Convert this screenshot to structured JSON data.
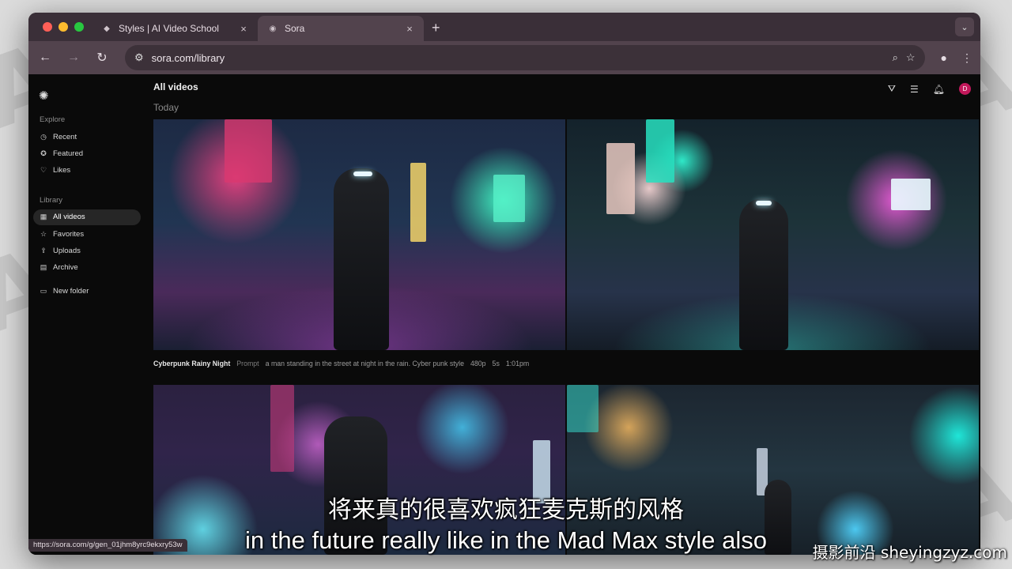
{
  "browser": {
    "tabs": [
      {
        "title": "Styles | AI Video School",
        "favicon": "ai-vs-icon",
        "close": "×"
      },
      {
        "title": "Sora",
        "favicon": "play-circle-icon",
        "close": "×"
      }
    ],
    "new_tab": "+",
    "address": "sora.com/library",
    "status_url": "https://sora.com/g/gen_01jhm8yrc9ekxry53w"
  },
  "sidebar": {
    "explore_label": "Explore",
    "explore_items": [
      {
        "label": "Recent",
        "icon": "clock-icon"
      },
      {
        "label": "Featured",
        "icon": "star-badge-icon"
      },
      {
        "label": "Likes",
        "icon": "heart-icon"
      }
    ],
    "library_label": "Library",
    "library_items": [
      {
        "label": "All videos",
        "icon": "grid-icon",
        "active": true
      },
      {
        "label": "Favorites",
        "icon": "star-icon"
      },
      {
        "label": "Uploads",
        "icon": "upload-icon"
      },
      {
        "label": "Archive",
        "icon": "archive-icon"
      }
    ],
    "new_folder": "New folder"
  },
  "main": {
    "title": "All videos",
    "group_label": "Today",
    "avatar_initial": "D",
    "video": {
      "title": "Cyberpunk Rainy Night",
      "prompt_label": "Prompt",
      "prompt": "a man standing in the street at night in the rain. Cyber punk style",
      "resolution": "480p",
      "duration": "5s",
      "time": "1:01pm"
    }
  },
  "overlay": {
    "subtitle_cn": "将来真的很喜欢疯狂麦克斯的风格",
    "subtitle_en": "in the future really like in the Mad Max style also",
    "watermark": "摄影前沿 sheyingzyz.com"
  },
  "colors": {
    "accent_avatar": "#c2185b",
    "traffic_red": "#ff5f57",
    "traffic_yellow": "#febc2e",
    "traffic_green": "#28c840"
  }
}
